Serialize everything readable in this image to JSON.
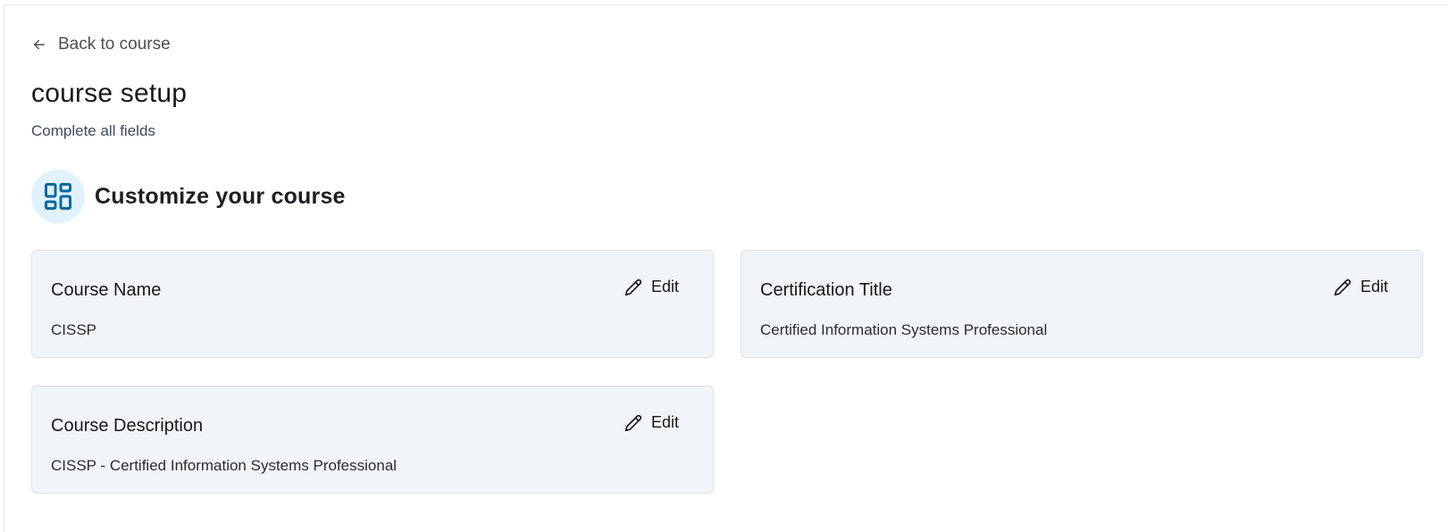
{
  "navigation": {
    "back_label": "Back to course",
    "back_icon": "arrow-left-icon"
  },
  "header": {
    "title": "course setup",
    "subtitle": "Complete all fields"
  },
  "section": {
    "title": "Customize your course",
    "icon": "layout-dashboard-icon"
  },
  "fields": [
    {
      "label": "Course Name",
      "value": "CISSP",
      "edit_label": "Edit"
    },
    {
      "label": "Certification Title",
      "value": "Certified Information Systems Professional",
      "edit_label": "Edit"
    },
    {
      "label": "Course Description",
      "value": "CISSP - Certified Information Systems Professional",
      "edit_label": "Edit"
    }
  ],
  "colors": {
    "accent": "#0369a1",
    "accent_bg": "#e0f2fe",
    "card_bg": "#f1f4f8"
  }
}
